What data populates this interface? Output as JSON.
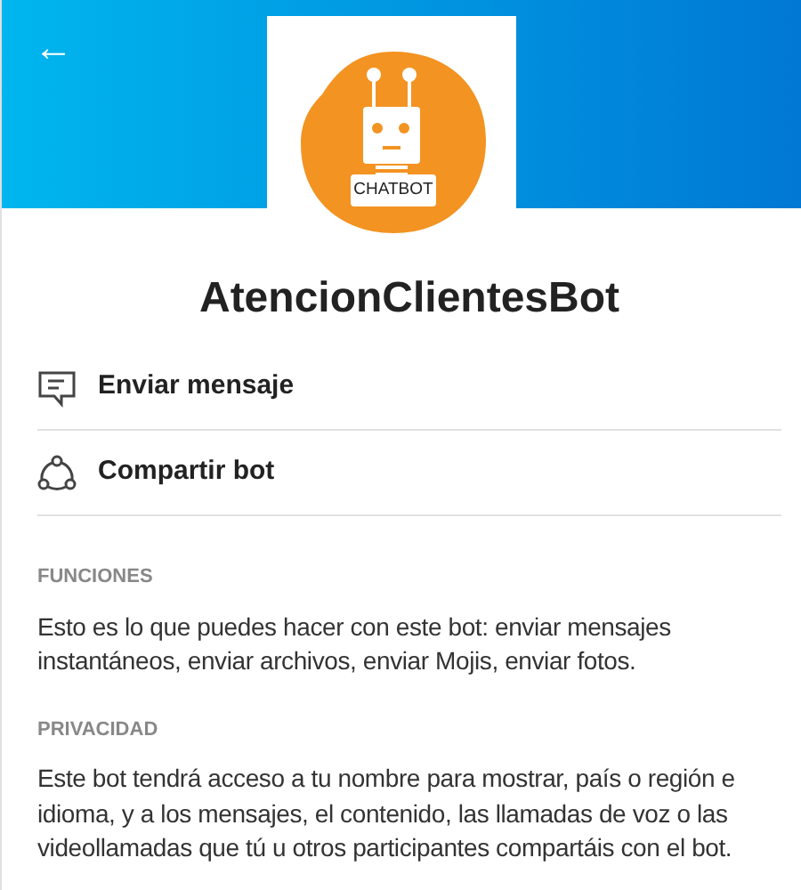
{
  "header": {
    "back_button": "←"
  },
  "avatar": {
    "label": "CHATBOT"
  },
  "bot_name": "AtencionClientesBot",
  "actions": [
    {
      "kind": "message",
      "label": "Enviar mensaje"
    },
    {
      "kind": "share",
      "label": "Compartir bot"
    }
  ],
  "sections": [
    {
      "heading": "FUNCIONES",
      "text": "Esto es lo que puedes hacer con este bot: enviar mensajes instantáneos, enviar archivos, enviar Mojis, enviar fotos."
    },
    {
      "heading": "PRIVACIDAD",
      "text": "Este bot tendrá acceso a tu nombre para mostrar, país o región e idioma, y a los mensajes, el contenido, las llamadas de voz o las videollamadas que tú u otros participantes compartáis con el bot."
    }
  ]
}
